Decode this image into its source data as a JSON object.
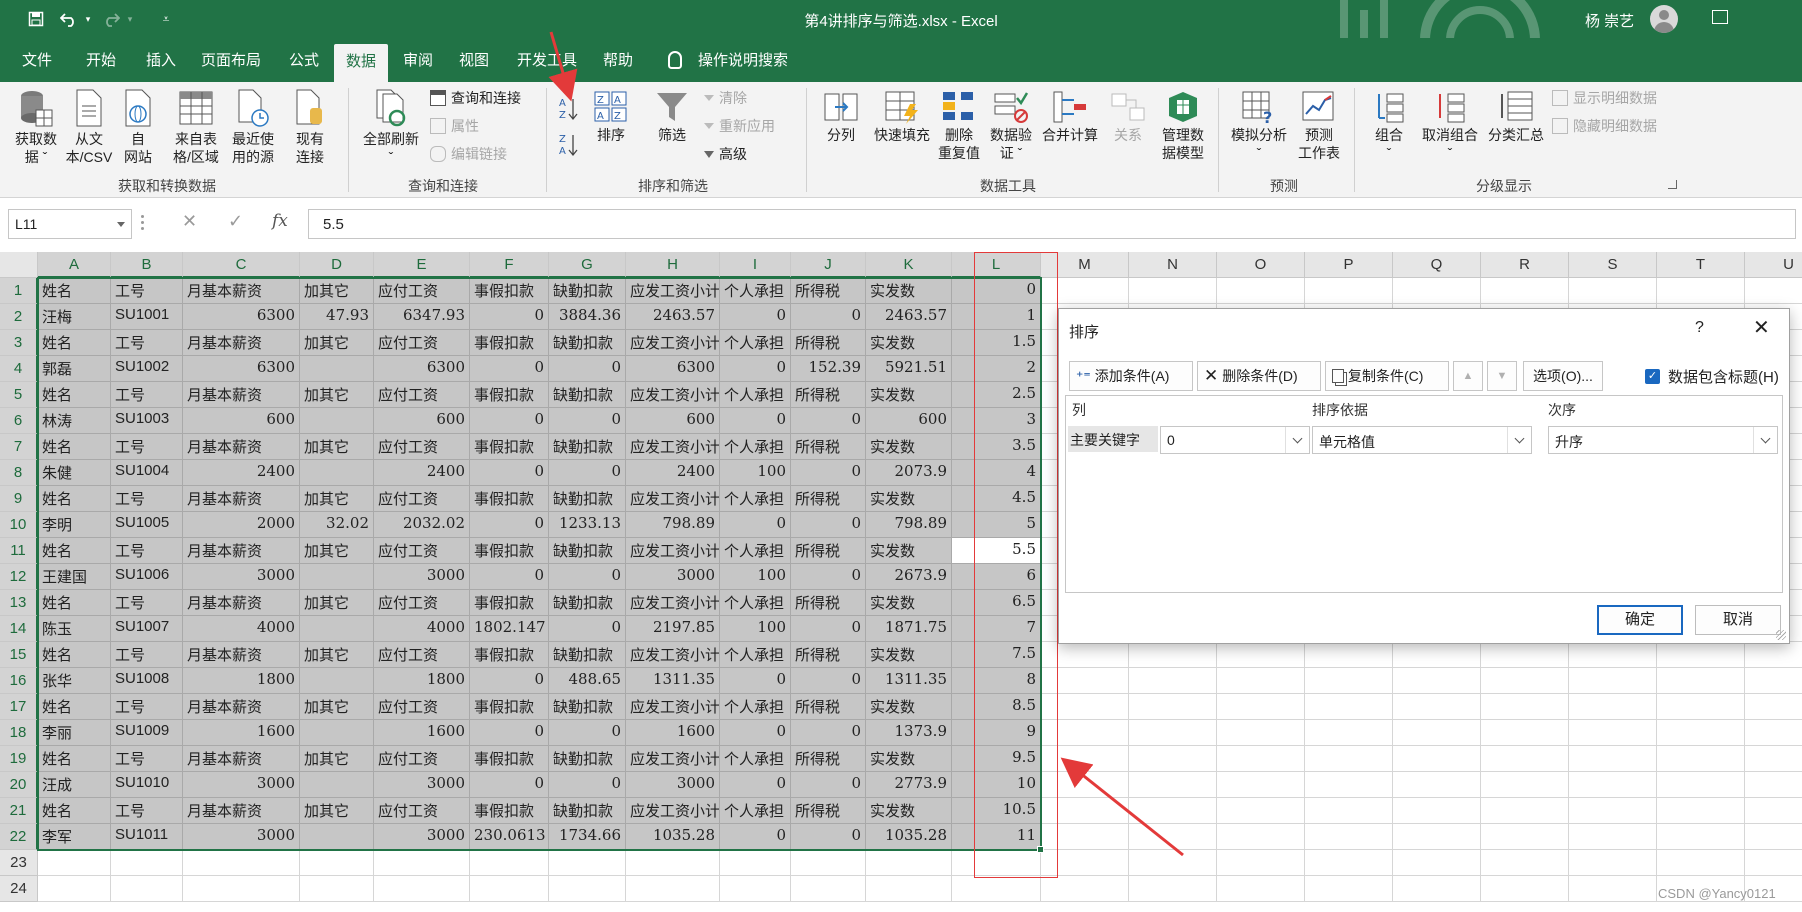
{
  "window": {
    "title": "第4讲排序与筛选.xlsx - Excel",
    "user": "杨 崇艺"
  },
  "tabs": [
    "文件",
    "开始",
    "插入",
    "页面布局",
    "公式",
    "数据",
    "审阅",
    "视图",
    "开发工具",
    "帮助",
    "操作说明搜索"
  ],
  "active_tab": "数据",
  "ribbon": {
    "get_data": [
      "获取数",
      "据 ˇ"
    ],
    "from_text": [
      "从文",
      "本/CSV"
    ],
    "from_web": [
      "自",
      "网站"
    ],
    "from_table": [
      "来自表",
      "格/区域"
    ],
    "recent_sources": [
      "最近使",
      "用的源"
    ],
    "existing_conn": [
      "现有",
      "连接"
    ],
    "group_get": "获取和转换数据",
    "refresh_all": [
      "全部刷新",
      "ˇ"
    ],
    "query_conn": "查询和连接",
    "properties": "属性",
    "edit_links": "编辑链接",
    "group_query": "查询和连接",
    "sort": "排序",
    "filter": "筛选",
    "clear": "清除",
    "reapply": "重新应用",
    "advanced": "高级",
    "group_sort": "排序和筛选",
    "text_to_columns": "分列",
    "flash_fill": "快速填充",
    "remove_dup": [
      "删除",
      "重复值"
    ],
    "data_validation": [
      "数据验",
      "证 ˇ"
    ],
    "consolidate": "合并计算",
    "relationships": "关系",
    "data_model": [
      "管理数",
      "据模型"
    ],
    "group_tools": "数据工具",
    "what_if": [
      "模拟分析",
      "ˇ"
    ],
    "forecast_sheet": [
      "预测",
      "工作表"
    ],
    "group_forecast": "预测",
    "group_btn": [
      "组合",
      "ˇ"
    ],
    "ungroup": [
      "取消组合",
      "ˇ"
    ],
    "subtotal": "分类汇总",
    "show_detail": "显示明细数据",
    "hide_detail": "隐藏明细数据",
    "group_outline": "分级显示"
  },
  "formula_bar": {
    "name_box": "L11",
    "value": "5.5",
    "fx": "fx"
  },
  "columns": [
    "A",
    "B",
    "C",
    "D",
    "E",
    "F",
    "G",
    "H",
    "I",
    "J",
    "K",
    "L",
    "M",
    "N",
    "O",
    "P",
    "Q",
    "R",
    "S",
    "T",
    "U"
  ],
  "row_numbers": [
    "1",
    "2",
    "3",
    "4",
    "5",
    "6",
    "7",
    "8",
    "9",
    "10",
    "11",
    "12",
    "13",
    "14",
    "15",
    "16",
    "17",
    "18",
    "19",
    "20",
    "21",
    "22",
    "23",
    "24"
  ],
  "rows": [
    [
      "姓名",
      "工号",
      "月基本薪资",
      "加其它",
      "应付工资",
      "事假扣款",
      "缺勤扣款",
      "应发工资小计",
      "个人承担",
      "所得税",
      "实发数",
      "0"
    ],
    [
      "汪梅",
      "SU1001",
      "6300",
      "47.93",
      "6347.93",
      "0",
      "3884.36",
      "2463.57",
      "0",
      "0",
      "2463.57",
      "1"
    ],
    [
      "姓名",
      "工号",
      "月基本薪资",
      "加其它",
      "应付工资",
      "事假扣款",
      "缺勤扣款",
      "应发工资小计",
      "个人承担",
      "所得税",
      "实发数",
      "1.5"
    ],
    [
      "郭磊",
      "SU1002",
      "6300",
      "",
      "6300",
      "0",
      "0",
      "6300",
      "0",
      "152.39",
      "5921.51",
      "2"
    ],
    [
      "姓名",
      "工号",
      "月基本薪资",
      "加其它",
      "应付工资",
      "事假扣款",
      "缺勤扣款",
      "应发工资小计",
      "个人承担",
      "所得税",
      "实发数",
      "2.5"
    ],
    [
      "林涛",
      "SU1003",
      "600",
      "",
      "600",
      "0",
      "0",
      "600",
      "0",
      "0",
      "600",
      "3"
    ],
    [
      "姓名",
      "工号",
      "月基本薪资",
      "加其它",
      "应付工资",
      "事假扣款",
      "缺勤扣款",
      "应发工资小计",
      "个人承担",
      "所得税",
      "实发数",
      "3.5"
    ],
    [
      "朱健",
      "SU1004",
      "2400",
      "",
      "2400",
      "0",
      "0",
      "2400",
      "100",
      "0",
      "2073.9",
      "4"
    ],
    [
      "姓名",
      "工号",
      "月基本薪资",
      "加其它",
      "应付工资",
      "事假扣款",
      "缺勤扣款",
      "应发工资小计",
      "个人承担",
      "所得税",
      "实发数",
      "4.5"
    ],
    [
      "李明",
      "SU1005",
      "2000",
      "32.02",
      "2032.02",
      "0",
      "1233.13",
      "798.89",
      "0",
      "0",
      "798.89",
      "5"
    ],
    [
      "姓名",
      "工号",
      "月基本薪资",
      "加其它",
      "应付工资",
      "事假扣款",
      "缺勤扣款",
      "应发工资小计",
      "个人承担",
      "所得税",
      "实发数",
      "5.5"
    ],
    [
      "王建国",
      "SU1006",
      "3000",
      "",
      "3000",
      "0",
      "0",
      "3000",
      "100",
      "0",
      "2673.9",
      "6"
    ],
    [
      "姓名",
      "工号",
      "月基本薪资",
      "加其它",
      "应付工资",
      "事假扣款",
      "缺勤扣款",
      "应发工资小计",
      "个人承担",
      "所得税",
      "实发数",
      "6.5"
    ],
    [
      "陈玉",
      "SU1007",
      "4000",
      "",
      "4000",
      "1802.147",
      "0",
      "2197.85",
      "100",
      "0",
      "1871.75",
      "7"
    ],
    [
      "姓名",
      "工号",
      "月基本薪资",
      "加其它",
      "应付工资",
      "事假扣款",
      "缺勤扣款",
      "应发工资小计",
      "个人承担",
      "所得税",
      "实发数",
      "7.5"
    ],
    [
      "张华",
      "SU1008",
      "1800",
      "",
      "1800",
      "0",
      "488.65",
      "1311.35",
      "0",
      "0",
      "1311.35",
      "8"
    ],
    [
      "姓名",
      "工号",
      "月基本薪资",
      "加其它",
      "应付工资",
      "事假扣款",
      "缺勤扣款",
      "应发工资小计",
      "个人承担",
      "所得税",
      "实发数",
      "8.5"
    ],
    [
      "李丽",
      "SU1009",
      "1600",
      "",
      "1600",
      "0",
      "0",
      "1600",
      "0",
      "0",
      "1373.9",
      "9"
    ],
    [
      "姓名",
      "工号",
      "月基本薪资",
      "加其它",
      "应付工资",
      "事假扣款",
      "缺勤扣款",
      "应发工资小计",
      "个人承担",
      "所得税",
      "实发数",
      "9.5"
    ],
    [
      "汪成",
      "SU1010",
      "3000",
      "",
      "3000",
      "0",
      "0",
      "3000",
      "0",
      "0",
      "2773.9",
      "10"
    ],
    [
      "姓名",
      "工号",
      "月基本薪资",
      "加其它",
      "应付工资",
      "事假扣款",
      "缺勤扣款",
      "应发工资小计",
      "个人承担",
      "所得税",
      "实发数",
      "10.5"
    ],
    [
      "李军",
      "SU1011",
      "3000",
      "",
      "3000",
      "230.0613",
      "1734.66",
      "1035.28",
      "0",
      "0",
      "1035.28",
      "11"
    ]
  ],
  "sort_dialog": {
    "title": "排序",
    "help": "?",
    "add_level": "添加条件(A)",
    "delete_level": "删除条件(D)",
    "copy_level": "复制条件(C)",
    "options": "选项(O)...",
    "has_headers": "数据包含标题(H)",
    "col_header": "列",
    "sort_on_header": "排序依据",
    "order_header": "次序",
    "level_label": "主要关键字",
    "column_value": "0",
    "sort_on_value": "单元格值",
    "order_value": "升序",
    "ok": "确定",
    "cancel": "取消"
  },
  "watermark": "CSDN @Yancy0121",
  "colors": {
    "excel_green": "#217346",
    "annotation_red": "#e33a3a",
    "selection_gray": "#c6c6c6"
  }
}
